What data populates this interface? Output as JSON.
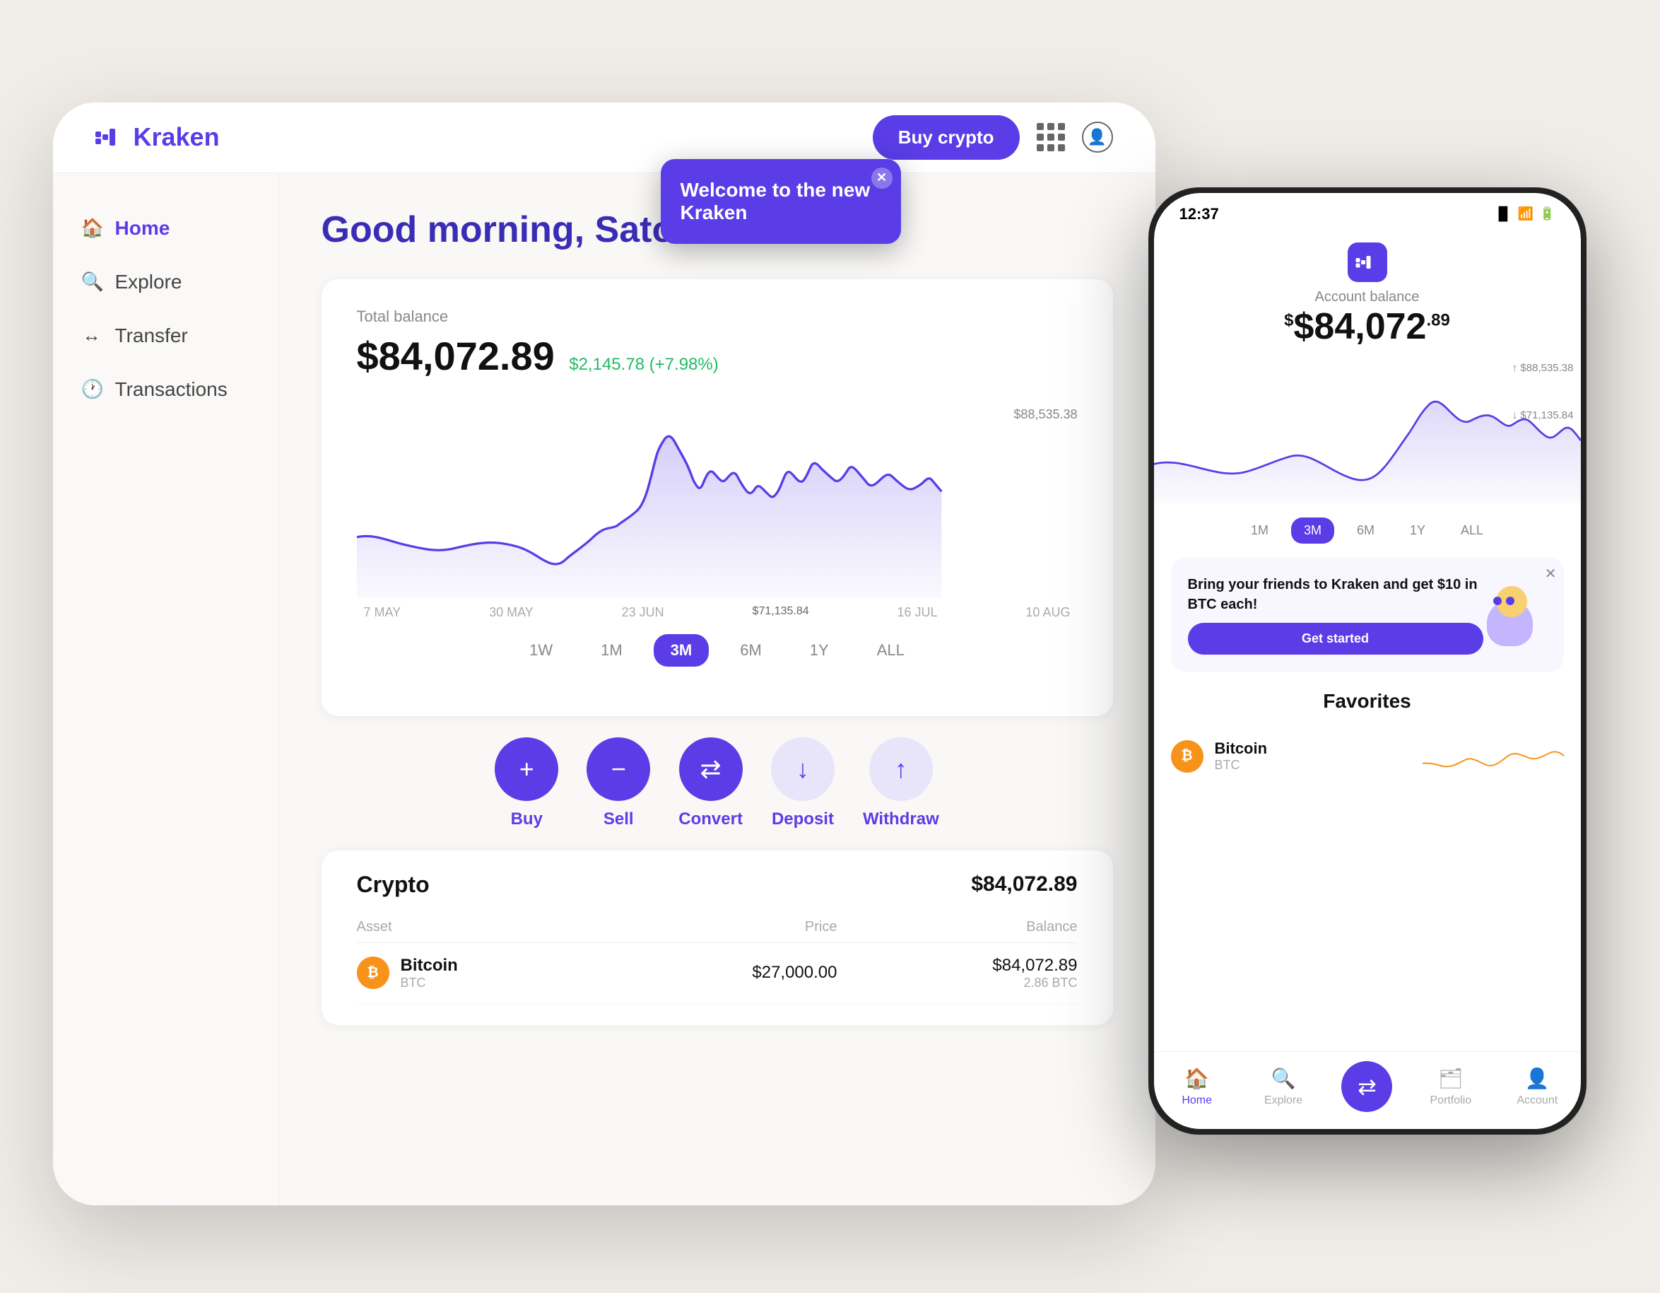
{
  "app": {
    "name": "Kraken"
  },
  "header": {
    "buy_crypto_label": "Buy crypto",
    "logo_text": "kraken"
  },
  "sidebar": {
    "items": [
      {
        "id": "home",
        "label": "Home",
        "active": true
      },
      {
        "id": "explore",
        "label": "Explore",
        "active": false
      },
      {
        "id": "transfer",
        "label": "Transfer",
        "active": false
      },
      {
        "id": "transactions",
        "label": "Transactions",
        "active": false
      }
    ]
  },
  "main": {
    "greeting": "Good morning, Satoshi",
    "balance": {
      "label": "Total balance",
      "amount": "$84,072.89",
      "change": "$2,145.78 (+7.98%)"
    },
    "chart": {
      "high_label": "$88,535.38",
      "low_label": "$71,135.84",
      "x_labels": [
        "7 MAY",
        "30 MAY",
        "23 JUN",
        "16 JUL",
        "10 AUG"
      ],
      "mid_label": "$71,135.84"
    },
    "time_filters": [
      "1W",
      "1M",
      "3M",
      "6M",
      "1Y",
      "ALL"
    ],
    "active_filter": "3M",
    "actions": [
      {
        "id": "buy",
        "label": "Buy",
        "type": "solid",
        "symbol": "+"
      },
      {
        "id": "sell",
        "label": "Sell",
        "type": "solid",
        "symbol": "−"
      },
      {
        "id": "convert",
        "label": "Convert",
        "type": "solid",
        "symbol": "⇄"
      },
      {
        "id": "deposit",
        "label": "Deposit",
        "type": "light",
        "symbol": "↓"
      },
      {
        "id": "withdraw",
        "label": "Withdraw",
        "type": "light",
        "symbol": "↑"
      }
    ],
    "portfolio": {
      "title": "Crypto",
      "total": "$84,072.89",
      "columns": [
        "Asset",
        "Price",
        "Balance"
      ],
      "rows": [
        {
          "name": "Bitcoin",
          "ticker": "BTC",
          "price": "$27,000.00",
          "balance_usd": "$84,072.89",
          "balance_crypto": "2.86 BTC"
        }
      ]
    }
  },
  "popup": {
    "title": "Welcome to the new Kraken"
  },
  "phone": {
    "status_time": "12:37",
    "balance_label": "Account balance",
    "balance_dollars": "$84,072",
    "balance_cents": ".89",
    "chart_high": "↑ $88,535.38",
    "chart_low": "↓ $71,135.84",
    "time_filters": [
      "1M",
      "3M",
      "6M",
      "1Y",
      "ALL"
    ],
    "active_filter": "3M",
    "referral": {
      "text": "Bring your friends to Kraken and get $10 in BTC each!",
      "button": "Get started"
    },
    "favorites_title": "Favorites",
    "favorites": [
      {
        "name": "Bitcoin",
        "ticker": "BTC"
      }
    ],
    "nav": [
      {
        "id": "home",
        "label": "Home",
        "active": true
      },
      {
        "id": "explore",
        "label": "Explore",
        "active": false
      },
      {
        "id": "convert",
        "label": "",
        "active": false,
        "center": true
      },
      {
        "id": "portfolio",
        "label": "Portfolio",
        "active": false
      },
      {
        "id": "account",
        "label": "Account",
        "active": false
      }
    ]
  }
}
